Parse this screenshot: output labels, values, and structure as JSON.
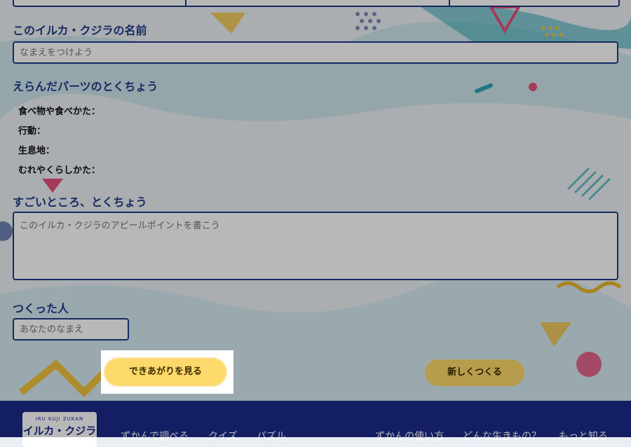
{
  "form": {
    "name_heading": "このイルカ・クジラの名前",
    "name_placeholder": "なまえをつけよう",
    "parts_heading": "えらんだパーツのとくちょう",
    "traits": [
      "食べ物や食べかた：",
      "行動：",
      "生息地：",
      "むれやくらしかた："
    ],
    "appeal_heading": "すごいところ、とくちょう",
    "appeal_placeholder": "このイルカ・クジラのアピールポイントを書こう",
    "creator_heading": "つくった人",
    "creator_placeholder": "あなたのなまえ"
  },
  "buttons": {
    "view_result": "できあがりを見る",
    "new_create": "新しくつくる"
  },
  "footer": {
    "logo_small": "IRU KUJI ZUKAN",
    "logo_big": "イルカ・クジラ",
    "nav": [
      "ずかんで調べる",
      "クイズ",
      "パズル",
      "ずかんの使い方",
      "どんな生きもの？",
      "もっと知る"
    ]
  },
  "colors": {
    "accent": "#1e3a8a",
    "button": "#fdd86a",
    "footer": "#1b2a8a"
  }
}
